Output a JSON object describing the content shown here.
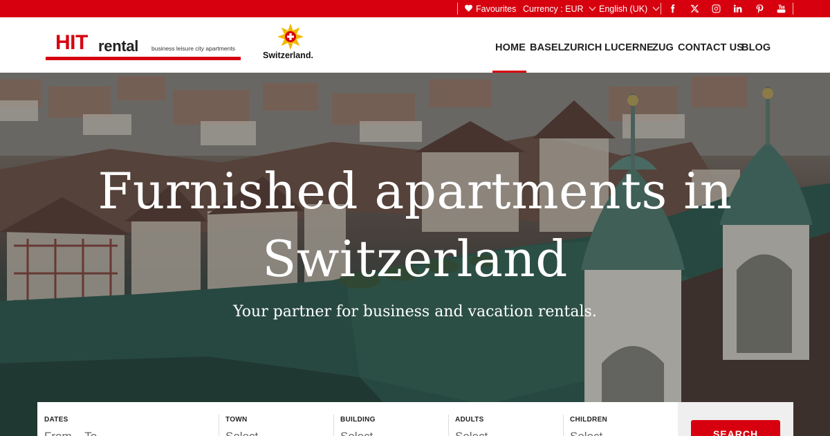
{
  "topbar": {
    "favourites_label": "Favourites",
    "currency_label": "Currency : EUR",
    "language_label": "English (UK)",
    "social_icons": [
      "facebook-icon",
      "x-twitter-icon",
      "instagram-icon",
      "linkedin-icon",
      "pinterest-icon",
      "youtube-icon"
    ],
    "background_color": "#d7000f"
  },
  "header": {
    "logo": {
      "hit": "HIT",
      "rental": "rental",
      "tagline": "business leisure city apartments"
    },
    "partner_logo_text": "Switzerland.",
    "nav": [
      "HOME",
      "BASEL",
      "ZURICH",
      "LUCERNE",
      "ZUG",
      "CONTACT US",
      "BLOG"
    ],
    "active_nav": "HOME"
  },
  "hero": {
    "title_line1": "Furnished apartments in",
    "title_line2": "Switzerland",
    "subtitle": "Your partner for business and vacation rentals."
  },
  "search": {
    "fields": [
      {
        "label": "DATES",
        "value": "From – To"
      },
      {
        "label": "TOWN",
        "value": "Select"
      },
      {
        "label": "BUILDING",
        "value": "Select"
      },
      {
        "label": "ADULTS",
        "value": "Select"
      },
      {
        "label": "CHILDREN",
        "value": "Select"
      }
    ],
    "button_label": "SEARCH"
  },
  "colors": {
    "accent": "#d7000f",
    "nav_text": "#222222"
  }
}
